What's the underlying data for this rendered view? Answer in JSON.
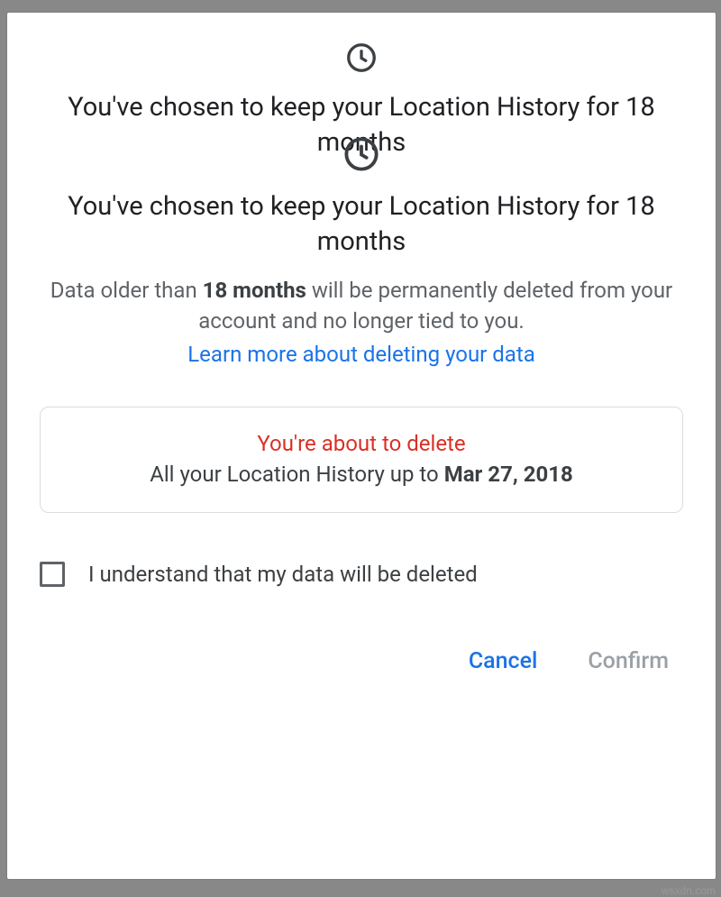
{
  "icon": "clock-icon",
  "partial_heading": "You've chosen to keep your Location History for 18 months",
  "main_heading": "You've chosen to keep your Location History for 18 months",
  "body": {
    "prefix": "Data older than ",
    "strong": "18 months",
    "suffix": " will be permanently deleted from your account and no longer tied to you."
  },
  "learn_more": "Learn more about deleting your data",
  "warning": {
    "title": "You're about to delete",
    "body_prefix": "All your Location History up to ",
    "date": "Mar 27, 2018"
  },
  "consent": {
    "checked": false,
    "label": "I understand that my data will be deleted"
  },
  "buttons": {
    "cancel": "Cancel",
    "confirm": "Confirm"
  },
  "watermark": "wsxdn.com"
}
